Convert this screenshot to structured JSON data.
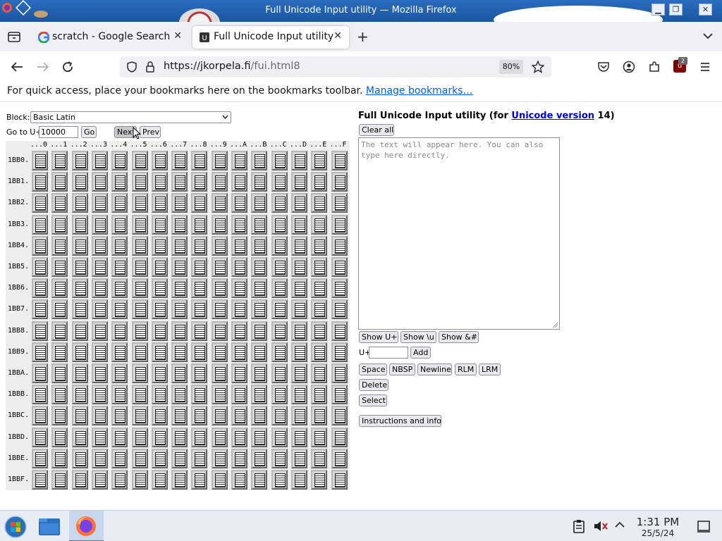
{
  "window": {
    "title": "Full Unicode Input utility — Mozilla Firefox"
  },
  "tabs": [
    {
      "label": "scratch - Google Search",
      "icon": "google-icon"
    },
    {
      "label": "Full Unicode Input utility",
      "icon": "fui-icon",
      "active": true
    }
  ],
  "navbar": {
    "url_host": "https://jkorpela.fi",
    "url_path": "/fui.html8",
    "zoom": "80%",
    "extension_badge": "2"
  },
  "bookmarks_bar": {
    "message": "For quick access, place your bookmarks here on the bookmarks toolbar.",
    "link": "Manage bookmarks…"
  },
  "left_panel": {
    "block_label": "Block:",
    "block_value": "Basic Latin",
    "goto_label": "Go to U+",
    "goto_value": "10000",
    "go_button": "Go",
    "next_button": "Next",
    "prev_button": "Prev",
    "column_headers": [
      "...0",
      "...1",
      "...2",
      "...3",
      "...4",
      "...5",
      "...6",
      "...7",
      "...8",
      "...9",
      "...A",
      "...B",
      "...C",
      "...D",
      "...E",
      "...F"
    ],
    "row_headers": [
      "1BB0.",
      "1BB1.",
      "1BB2.",
      "1BB3.",
      "1BB4.",
      "1BB5.",
      "1BB6.",
      "1BB7.",
      "1BB8.",
      "1BB9.",
      "1BBA.",
      "1BBB.",
      "1BBC.",
      "1BBD.",
      "1BBE.",
      "1BBF."
    ]
  },
  "right_panel": {
    "heading_prefix": "Full Unicode Input utility (for ",
    "heading_link": "Unicode version",
    "heading_suffix": " 14)",
    "clear_all": "Clear all",
    "textarea_placeholder": "The text will appear here. You can also type here directly.",
    "show_buttons": [
      "Show U+",
      "Show \\u",
      "Show &#"
    ],
    "add_label": "U+",
    "add_value": "",
    "add_button": "Add",
    "insert_buttons": [
      "Space",
      "NBSP",
      "Newline",
      "RLM",
      "LRM"
    ],
    "delete_button": "Delete",
    "select_button": "Select",
    "instructions_button": "Instructions and info"
  },
  "taskbar": {
    "time": "1:31 PM",
    "date": "25/5/24"
  },
  "colors": {
    "titlebar": "#1b55a0",
    "tabstrip": "#f0f0f4",
    "link": "#0061e0",
    "heading_link": "#0000ee"
  }
}
